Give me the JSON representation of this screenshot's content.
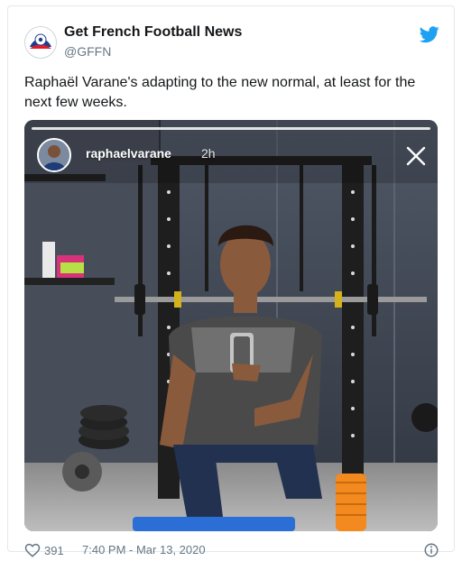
{
  "tweet": {
    "author_name": "Get French Football News",
    "author_handle": "@GFFN",
    "text": "Raphaël Varane's adapting to the new normal, at least for the next few weeks.",
    "likes": "391",
    "timestamp": "7:40 PM - Mar 13, 2020"
  },
  "story": {
    "username": "raphaelvarane",
    "time": "2h"
  },
  "colors": {
    "twitter_blue": "#1da1f2",
    "text_secondary": "#657786"
  },
  "icons": {
    "bird": "twitter-bird-icon",
    "heart": "heart-icon",
    "info": "info-icon",
    "close": "close-icon"
  }
}
